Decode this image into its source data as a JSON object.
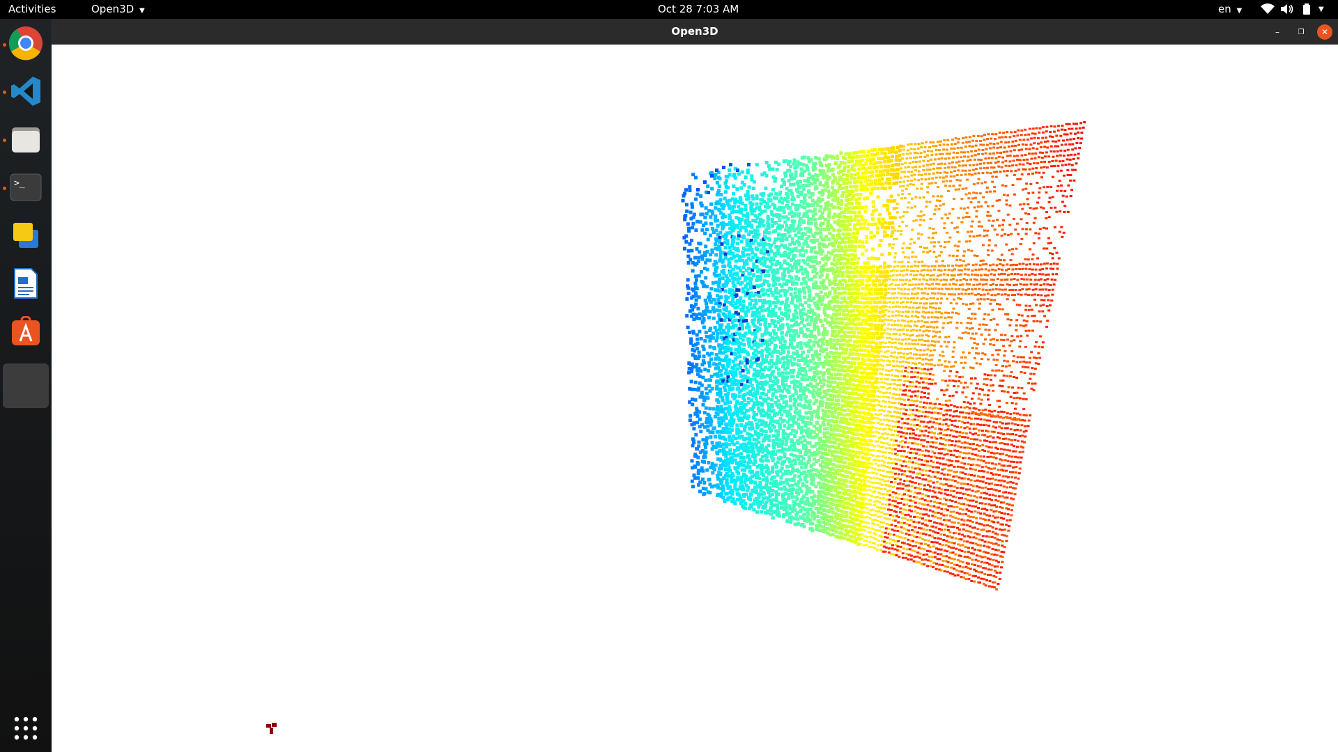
{
  "topbar": {
    "activities": "Activities",
    "app_menu": "Open3D",
    "clock": "Oct 28  7:03 AM",
    "language": "en"
  },
  "window": {
    "title": "Open3D",
    "minimize_icon": "minimize-icon",
    "restore_icon": "restore-icon",
    "close_icon": "close-icon"
  },
  "dock": {
    "items": [
      {
        "name": "chrome",
        "icon": "chrome-icon",
        "running": true
      },
      {
        "name": "vscode",
        "icon": "vscode-icon",
        "running": true
      },
      {
        "name": "files",
        "icon": "files-icon",
        "running": true
      },
      {
        "name": "terminal",
        "icon": "terminal-icon",
        "running": true
      },
      {
        "name": "slides",
        "icon": "slides-icon",
        "running": false
      },
      {
        "name": "writer",
        "icon": "writer-icon",
        "running": false
      },
      {
        "name": "software",
        "icon": "app-center-icon",
        "running": false
      },
      {
        "name": "open3d-window",
        "icon": "open3d-window-icon",
        "running": true
      }
    ],
    "show_apps_icon": "app-grid-icon"
  },
  "viewer": {
    "content": "point-cloud",
    "colormap": [
      "#0000a0",
      "#0066ff",
      "#00ffff",
      "#ffff00",
      "#ff8800",
      "#ff0000",
      "#8b0000"
    ]
  }
}
